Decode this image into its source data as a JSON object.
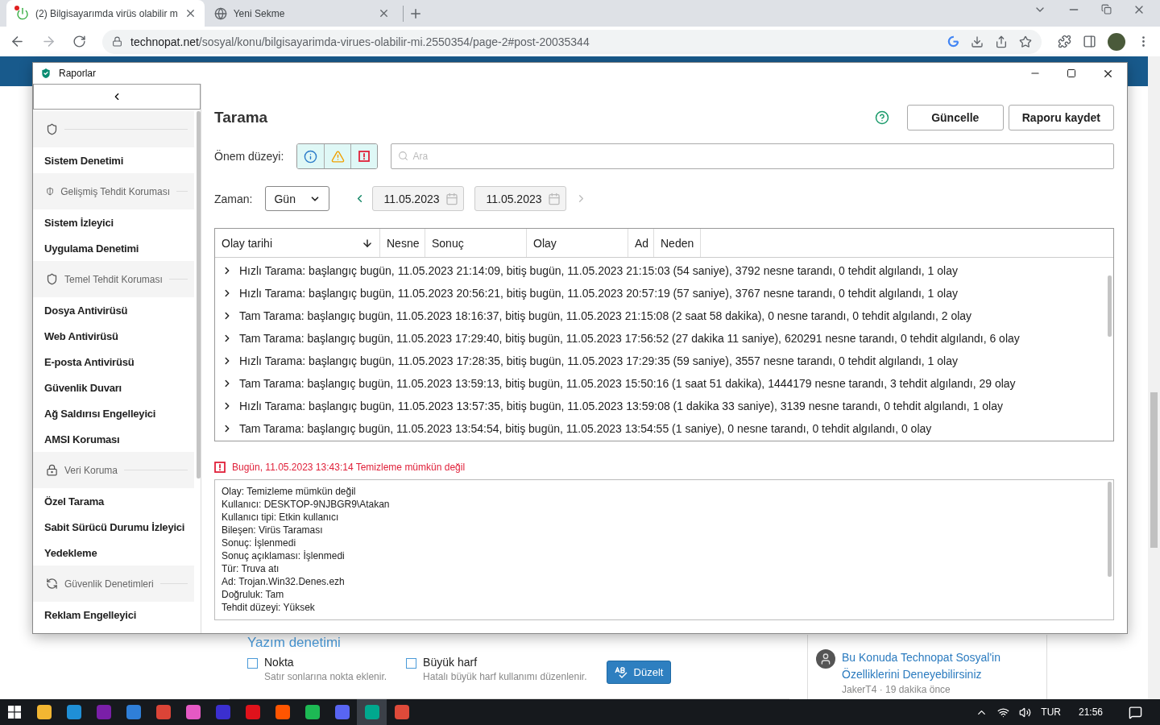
{
  "browser": {
    "tabs": [
      {
        "title": "(2) Bilgisayarımda virüs olabilir m",
        "selected": true,
        "notification": true
      },
      {
        "title": "Yeni Sekme",
        "selected": false,
        "notification": false
      }
    ],
    "address": {
      "host": "technopat.net",
      "path": "/sosyal/konu/bilgisayarimda-virues-olabilir-mi.2550354/page-2#post-20035344"
    }
  },
  "dialog": {
    "title": "Raporlar",
    "sidebar": [
      {
        "kind": "group"
      },
      {
        "kind": "item",
        "label": "Sistem Denetimi"
      },
      {
        "kind": "group",
        "label": "Gelişmiş Tehdit Koruması"
      },
      {
        "kind": "item",
        "label": "Sistem İzleyici"
      },
      {
        "kind": "item",
        "label": "Uygulama Denetimi"
      },
      {
        "kind": "group",
        "label": "Temel Tehdit Koruması"
      },
      {
        "kind": "item",
        "label": "Dosya Antivirüsü"
      },
      {
        "kind": "item",
        "label": "Web Antivirüsü"
      },
      {
        "kind": "item",
        "label": "E-posta Antivirüsü"
      },
      {
        "kind": "item",
        "label": "Güvenlik Duvarı"
      },
      {
        "kind": "item",
        "label": "Ağ Saldırısı Engelleyici"
      },
      {
        "kind": "item",
        "label": "AMSI Koruması"
      },
      {
        "kind": "group",
        "label": "Veri Koruma"
      },
      {
        "kind": "item",
        "label": "Özel Tarama"
      },
      {
        "kind": "item",
        "label": "Sabit Sürücü Durumu İzleyici"
      },
      {
        "kind": "item",
        "label": "Yedekleme"
      },
      {
        "kind": "group",
        "label": "Güvenlik Denetimleri"
      },
      {
        "kind": "item",
        "label": "Reklam Engelleyici"
      }
    ],
    "heading": "Tarama",
    "buttons": [
      "Güncelle",
      "Raporu kaydet"
    ],
    "severity": {
      "label": "Önem düzeyi:",
      "filters": [
        {
          "kind": "info",
          "selected": true
        },
        {
          "kind": "warning",
          "selected": true
        },
        {
          "kind": "critical",
          "selected": true
        }
      ]
    },
    "search": {
      "placeholder": "Ara"
    },
    "time": {
      "label": "Zaman:",
      "period": "Gün",
      "from": "11.05.2023",
      "to": "11.05.2023",
      "prev_disabled": false,
      "next_disabled": true
    },
    "table": {
      "columns": [
        {
          "label": "Olay tarihi",
          "sorted": true
        },
        {
          "label": "Nesne"
        },
        {
          "label": "Sonuç"
        },
        {
          "label": "Olay"
        },
        {
          "label": "Ad"
        },
        {
          "label": "Neden"
        }
      ],
      "rows": [
        "Hızlı Tarama: başlangıç bugün, 11.05.2023 21:14:09, bitiş bugün, 11.05.2023 21:15:03 (54 saniye), 3792 nesne tarandı, 0 tehdit algılandı, 1 olay",
        "Hızlı Tarama: başlangıç bugün, 11.05.2023 20:56:21, bitiş bugün, 11.05.2023 20:57:19 (57 saniye), 3767 nesne tarandı, 0 tehdit algılandı, 1 olay",
        "Tam Tarama: başlangıç bugün, 11.05.2023 18:16:37, bitiş bugün, 11.05.2023 21:15:08 (2 saat 58 dakika), 0 nesne tarandı, 0 tehdit algılandı, 2 olay",
        "Tam Tarama: başlangıç bugün, 11.05.2023 17:29:40, bitiş bugün, 11.05.2023 17:56:52 (27 dakika 11 saniye), 620291 nesne tarandı, 0 tehdit algılandı, 6 olay",
        "Hızlı Tarama: başlangıç bugün, 11.05.2023 17:28:35, bitiş bugün, 11.05.2023 17:29:35 (59 saniye), 3557 nesne tarandı, 0 tehdit algılandı, 1 olay",
        "Tam Tarama: başlangıç bugün, 11.05.2023 13:59:13, bitiş bugün, 11.05.2023 15:50:16 (1 saat 51 dakika), 1444179 nesne tarandı, 3 tehdit algılandı, 29 olay",
        "Hızlı Tarama: başlangıç bugün, 11.05.2023 13:57:35, bitiş bugün, 11.05.2023 13:59:08 (1 dakika 33 saniye), 3139 nesne tarandı, 0 tehdit algılandı, 1 olay",
        "Tam Tarama: başlangıç bugün, 11.05.2023 13:54:54, bitiş bugün, 11.05.2023 13:54:55 (1 saniye), 0 nesne tarandı, 0 tehdit algılandı, 0 olay"
      ]
    },
    "event": {
      "kind": "critical",
      "title": "Bugün, 11.05.2023 13:43:14 Temizleme mümkün değil",
      "details": [
        "Olay: Temizleme mümkün değil",
        "Kullanıcı: DESKTOP-9NJBGR9\\Atakan",
        "Kullanıcı tipi: Etkin kullanıcı",
        "Bileşen: Virüs Taraması",
        "Sonuç: İşlenmedi",
        "Sonuç açıklaması: İşlenmedi",
        "Tür: Truva atı",
        "Ad: Trojan.Win32.Denes.ezh",
        "Doğruluk: Tam",
        "Tehdit düzeyi: Yüksek"
      ]
    }
  },
  "page": {
    "section_title": "Yazım denetimi",
    "options": [
      {
        "label": "Nokta",
        "hint": "Satır sonlarına nokta eklenir.",
        "checked": false
      },
      {
        "label": "Büyük harf",
        "hint": "Hatalı büyük harf kullanımı düzenlenir.",
        "checked": false
      }
    ],
    "fix_button": "Düzelt",
    "related": {
      "title": "Bu Konuda Technopat Sosyal'in Özelliklerini Deneyebilirsiniz",
      "meta": "JakerT4 · 19 dakika önce"
    }
  },
  "taskbar": {
    "apps": [
      {
        "color": "#f2b632",
        "selected": false
      },
      {
        "color": "#1f8fd6",
        "selected": false
      },
      {
        "color": "#7a1fa8",
        "selected": false
      },
      {
        "color": "#2f7fd8",
        "selected": false
      },
      {
        "color": "#db4437",
        "selected": false
      },
      {
        "color": "#e559c4",
        "selected": false
      },
      {
        "color": "#3b2fd0",
        "selected": false
      },
      {
        "color": "#e0121b",
        "selected": false
      },
      {
        "color": "#ff5500",
        "selected": false
      },
      {
        "color": "#1db954",
        "selected": false
      },
      {
        "color": "#5865f2",
        "selected": false
      },
      {
        "color": "#00a88e",
        "selected": true
      },
      {
        "color": "#de4a3a",
        "selected": false
      }
    ],
    "language": "TUR",
    "time": "21:56"
  }
}
